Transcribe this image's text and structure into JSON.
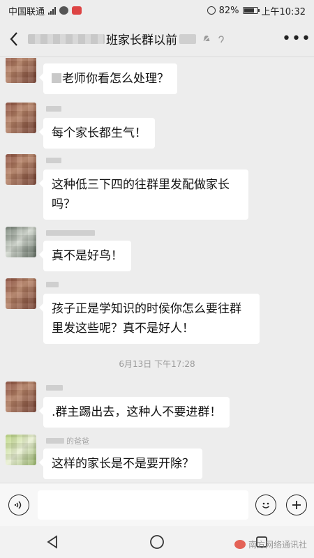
{
  "status_bar": {
    "carrier": "中国联通",
    "battery": "82%",
    "time": "上午10:32",
    "battery_level": 0.82
  },
  "header": {
    "title": "班家长群以前",
    "back_icon": "chevron-left-icon",
    "more_icon": "ellipsis-icon"
  },
  "messages": [
    {
      "text": "老师你看怎么处理？",
      "avatar": "avatar-red"
    },
    {
      "text": "每个家长都生气！",
      "avatar": "avatar-red"
    },
    {
      "text_line1": "这种低三下四的往群里发配做家长",
      "text_line2": "吗？",
      "avatar": "avatar-red"
    },
    {
      "text": "真不是好鸟！",
      "avatar": "avatar-gray"
    },
    {
      "text_line1": "孩子正是学知识的时侯你怎么要往群",
      "text_line2": "里发这些呢？真不是好人！",
      "avatar": "avatar-red"
    },
    {
      "text": ".群主踢出去，这种人不要进群！",
      "avatar": "avatar-red"
    },
    {
      "sender_suffix": "的爸爸",
      "text": "这样的家长是不是要开除？",
      "avatar": "avatar-green"
    }
  ],
  "time_separator": "6月13日 下午17:28",
  "input_bar": {
    "voice_icon": "voice-icon",
    "emoji_icon": "emoji-icon",
    "plus_icon": "plus-icon"
  },
  "watermark": "南方网络通讯社",
  "colors": {
    "background": "#ededed",
    "bubble": "#ffffff",
    "accent": "#111111"
  }
}
